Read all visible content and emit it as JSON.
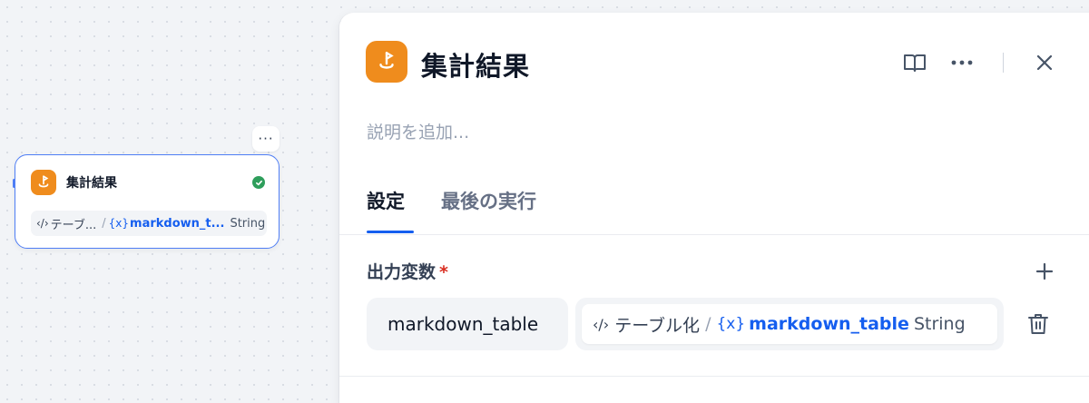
{
  "canvas": {
    "node": {
      "more_label": "···",
      "title": "集計結果",
      "icon": "answer-icon",
      "status_icon": "check-circle-icon",
      "status_color": "#2e9e5b",
      "variable": {
        "code_symbol": "‹/›",
        "source": "テーブ...",
        "separator": "/",
        "var_symbol": "{x}",
        "name": "markdown_t...",
        "type": "String"
      }
    }
  },
  "panel": {
    "title": "集計結果",
    "icon": "answer-icon",
    "icon_color": "#ef8c1d",
    "header_icons": [
      "book-icon",
      "more-icon",
      "close-icon"
    ],
    "description_placeholder": "説明を追加...",
    "tabs": [
      {
        "label": "設定",
        "active": true
      },
      {
        "label": "最後の実行",
        "active": false
      }
    ],
    "output_section": {
      "label": "出力変数",
      "required_mark": "*",
      "rows": [
        {
          "name": "markdown_table",
          "value": {
            "code_symbol": "‹/›",
            "source": "テーブル化",
            "separator": "/",
            "var_symbol": "{x}",
            "name": "markdown_table",
            "type": "String"
          }
        }
      ]
    },
    "accent_color": "#155eef"
  }
}
